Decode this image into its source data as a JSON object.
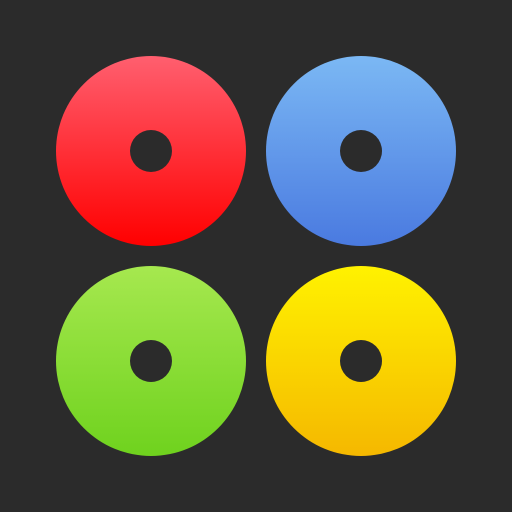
{
  "app_icon": {
    "background_color": "#2b2b2b",
    "discs": [
      {
        "name": "red",
        "top_color": "#ff5f6f",
        "bottom_color": "#ff0000"
      },
      {
        "name": "blue",
        "top_color": "#7bb8f4",
        "bottom_color": "#4a7ae0"
      },
      {
        "name": "green",
        "top_color": "#a6e84f",
        "bottom_color": "#6fd21e"
      },
      {
        "name": "yellow",
        "top_color": "#fff200",
        "bottom_color": "#f5b800"
      }
    ]
  }
}
